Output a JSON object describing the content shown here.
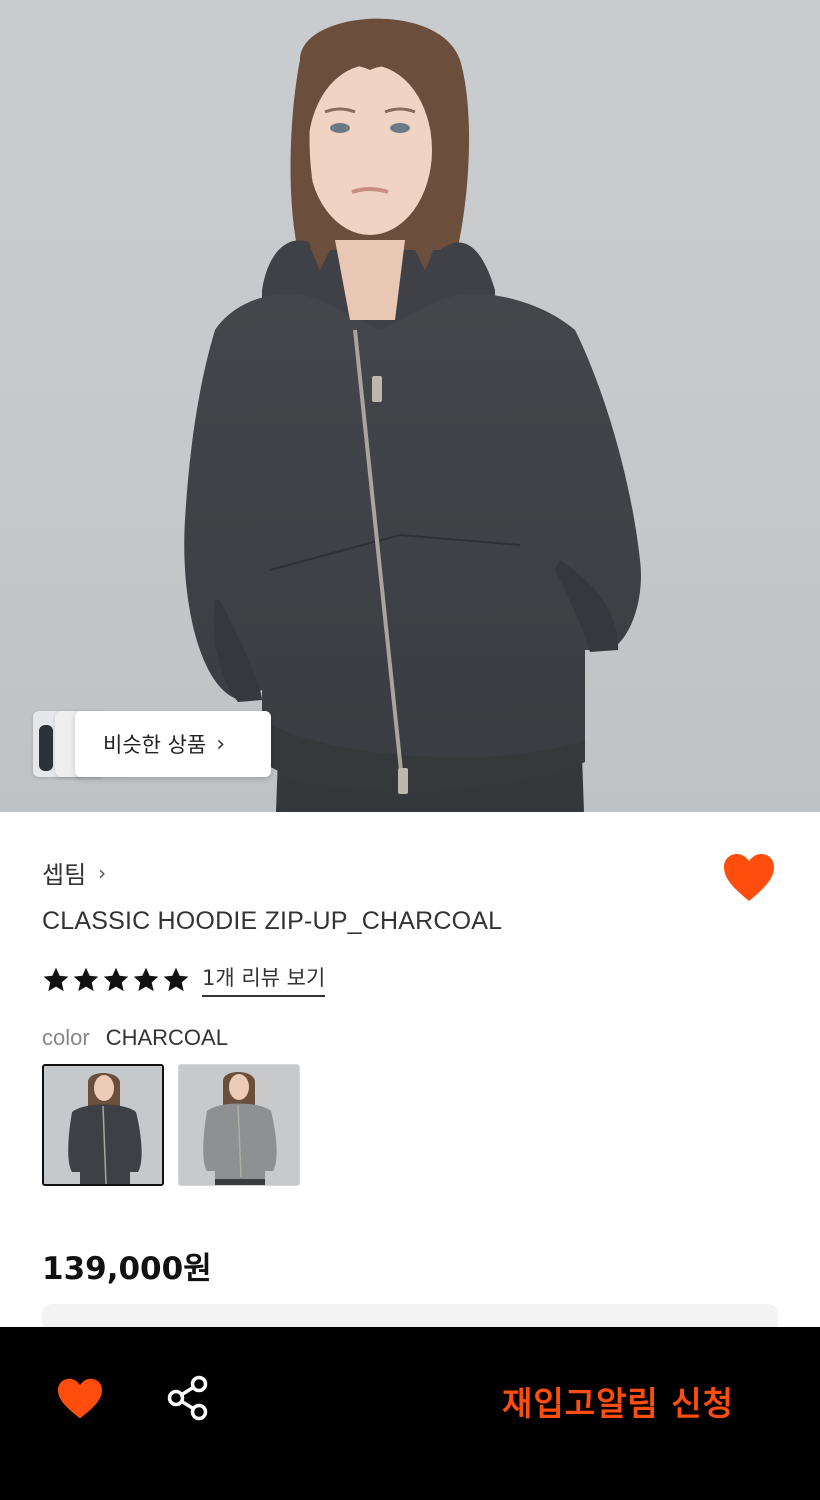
{
  "colors": {
    "accent": "#ff4d0d",
    "bottom_bar": "#000000",
    "text": "#333333"
  },
  "hero": {
    "image": "model-wearing-charcoal-zip-up-hoodie",
    "similar_products_label": "비슷한 상품",
    "similar_products_icon": "chevron-right-icon"
  },
  "product": {
    "brand": "셉팀",
    "brand_icon": "chevron-right-icon",
    "name": "CLASSIC HOODIE ZIP-UP_CHARCOAL",
    "rating_stars": 5,
    "rating_max": 5,
    "review_link": "1개 리뷰 보기",
    "color_label": "color",
    "color_value": "CHARCOAL",
    "swatches": [
      {
        "name": "CHARCOAL",
        "selected": true
      },
      {
        "name": "GRAY",
        "selected": false
      }
    ],
    "price": "139,000원",
    "wishlisted": true
  },
  "bottom_bar": {
    "wish_icon": "heart-icon",
    "share_icon": "share-icon",
    "restock_label": "재입고알림 신청"
  }
}
